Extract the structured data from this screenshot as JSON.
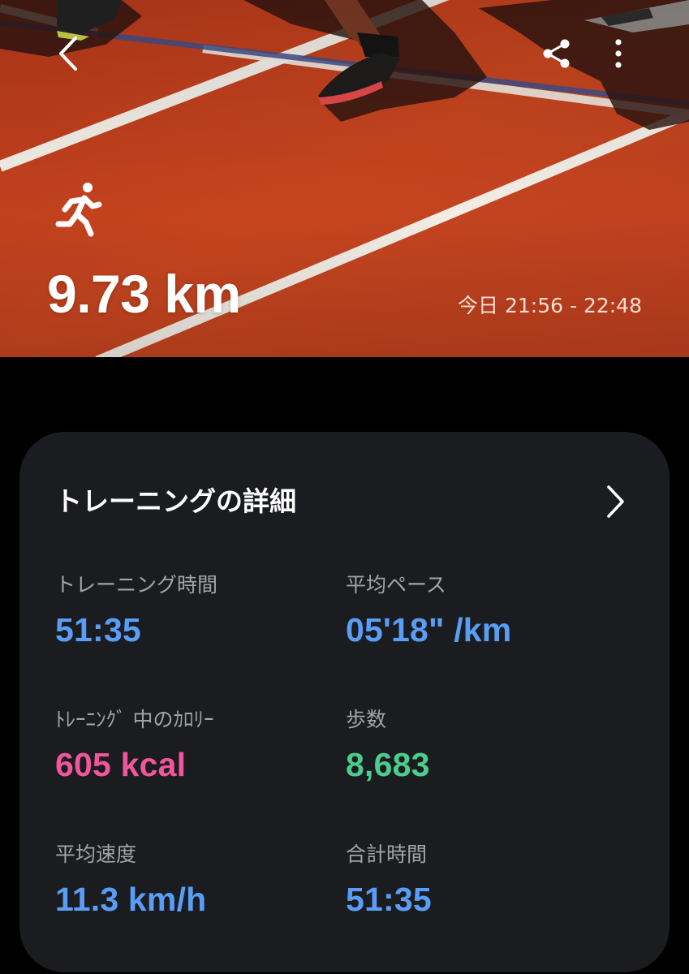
{
  "header": {
    "back_icon": "chevron-left-icon",
    "share_icon": "share-icon",
    "more_icon": "more-vertical-icon",
    "activity_icon": "running-person-icon",
    "distance": "9.73 km",
    "time_range": "今日 21:56 - 22:48"
  },
  "details": {
    "title": "トレーニングの詳細",
    "chevron_icon": "chevron-right-icon",
    "stats": [
      {
        "label": "トレーニング時間",
        "value": "51:35",
        "color": "#5a9df6"
      },
      {
        "label": "平均ペース",
        "value": "05'18\" /km",
        "color": "#5a9df6"
      },
      {
        "label": "ﾄﾚｰﾆﾝｸﾞ 中のｶﾛﾘｰ",
        "value": "605 kcal",
        "color": "#f0569a"
      },
      {
        "label": "歩数",
        "value": "8,683",
        "color": "#4ccd8e"
      },
      {
        "label": "平均速度",
        "value": "11.3 km/h",
        "color": "#5a9df6"
      },
      {
        "label": "合計時間",
        "value": "51:35",
        "color": "#5a9df6"
      }
    ]
  },
  "colors": {
    "track": "#c0401f",
    "card_background": "#1b1c1f",
    "screen_background": "#000000",
    "accent_blue": "#5a9df6",
    "accent_pink": "#f0569a",
    "accent_green": "#4ccd8e"
  }
}
